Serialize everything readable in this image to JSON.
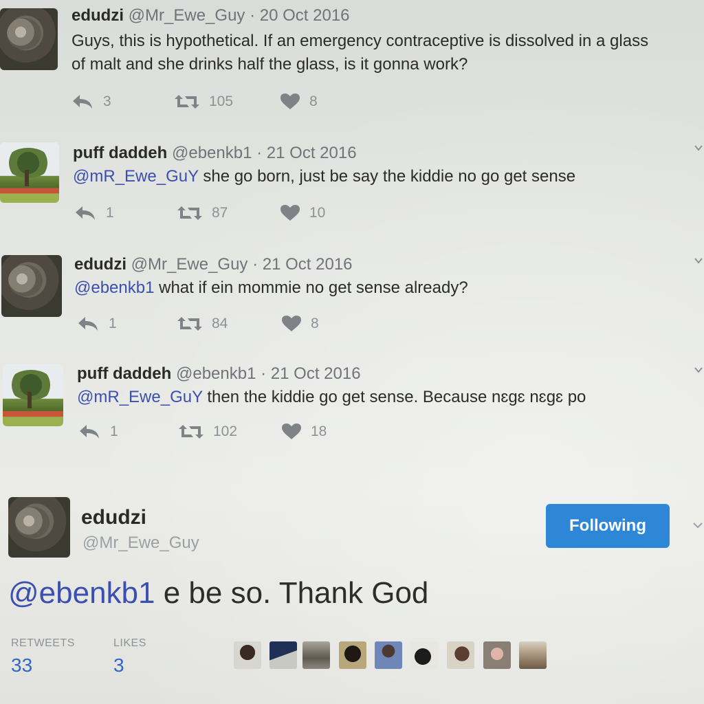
{
  "tweets": [
    {
      "name": "edudzi",
      "handle": "@Mr_Ewe_Guy",
      "separator": "·",
      "date": "20 Oct 2016",
      "text_line1": "Guys, this is hypothetical. If an emergency contraceptive is dissolved in a glass",
      "text_line2": "of malt and she drinks half the glass, is it gonna work?",
      "replies": "3",
      "retweets": "105",
      "likes": "8",
      "avatar": "koala-avatar"
    },
    {
      "name": "puff daddeh",
      "handle": "@ebenkb1",
      "separator": "·",
      "date": "21 Oct 2016",
      "mention": "@mR_Ewe_GuY",
      "text": " she go born, just be say the kiddie no go get sense",
      "replies": "1",
      "retweets": "87",
      "likes": "10",
      "avatar": "tree-avatar"
    },
    {
      "name": "edudzi",
      "handle": "@Mr_Ewe_Guy",
      "separator": "·",
      "date": "21 Oct 2016",
      "mention": "@ebenkb1",
      "text": " what if ein mommie no get sense already?",
      "replies": "1",
      "retweets": "84",
      "likes": "8",
      "avatar": "koala-avatar"
    },
    {
      "name": "puff daddeh",
      "handle": "@ebenkb1",
      "separator": "·",
      "date": "21 Oct 2016",
      "mention": "@mR_Ewe_GuY",
      "text": " then the kiddie go get sense. Because nɛgɛ nɛgɛ po",
      "replies": "1",
      "retweets": "102",
      "likes": "18",
      "avatar": "tree-avatar"
    }
  ],
  "focused": {
    "name": "edudzi",
    "handle": "@Mr_Ewe_Guy",
    "follow_label": "Following",
    "mention": "@ebenkb1",
    "text": " e be so. Thank God",
    "retweets_label": "RETWEETS",
    "retweets_count": "33",
    "likes_label": "LIKES",
    "likes_count": "3"
  },
  "colors": {
    "mention": "#3b4fb0",
    "follow_button": "#2d86d6",
    "stat_value": "#2f67c2",
    "action_icon": "#8d9195"
  },
  "icons": [
    "reply-icon",
    "retweet-icon",
    "heart-icon",
    "chevron-down-icon"
  ]
}
